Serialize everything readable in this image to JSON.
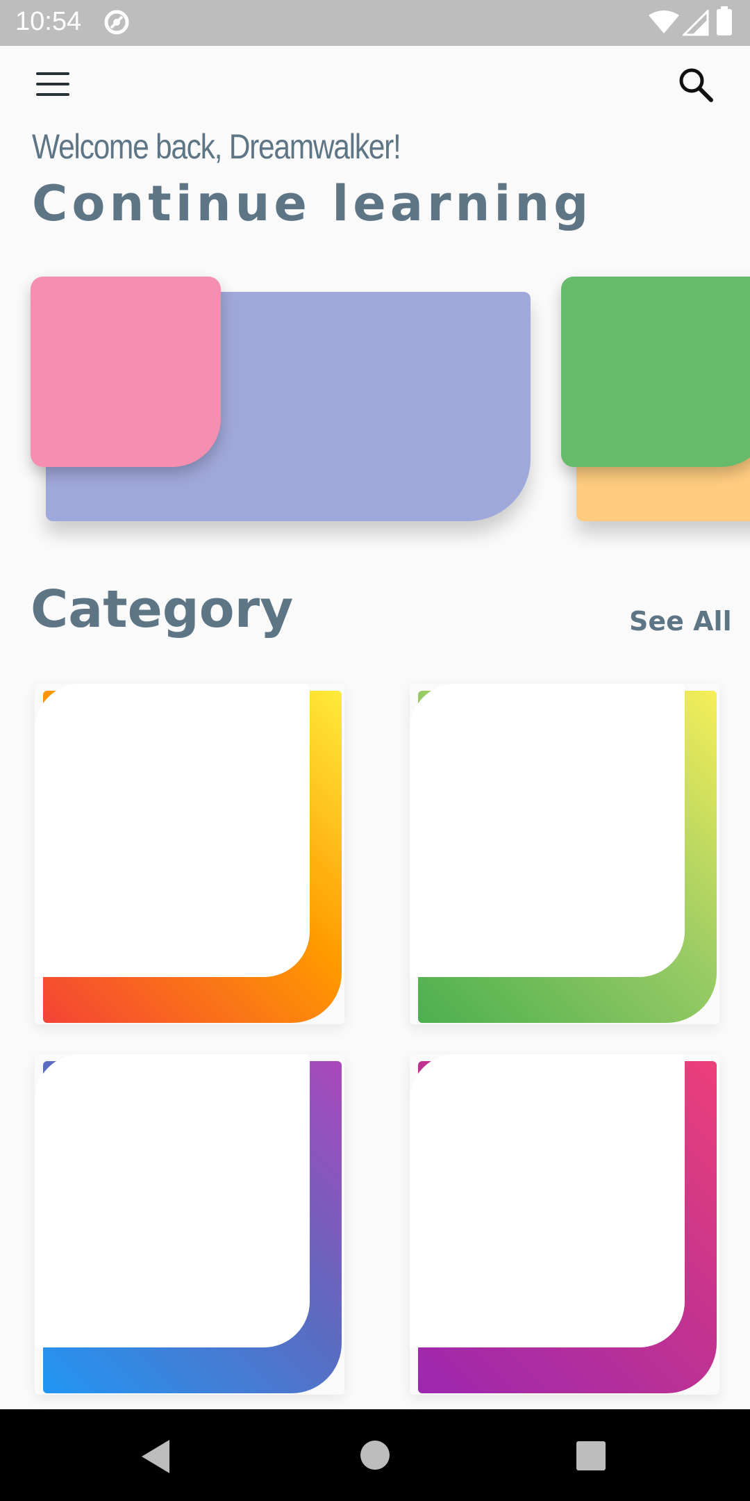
{
  "status_bar": {
    "time": "10:54"
  },
  "app_bar": {
    "menu_icon": "hamburger-menu-icon",
    "search_icon": "search-icon"
  },
  "header": {
    "welcome": "Welcome back, Dreamwalker!",
    "title": "Continue learning"
  },
  "continue_learning": [
    {
      "front_color": "#f48fb1",
      "back_color": "#9fa8da"
    },
    {
      "front_color": "#66bb6a",
      "back_color": "#ffcc80"
    }
  ],
  "category": {
    "title": "Category",
    "see_all": "See All",
    "cards": [
      {
        "gradient": [
          "#f44336",
          "#ffeb3b"
        ]
      },
      {
        "gradient": [
          "#4caf50",
          "#f6ee58"
        ]
      },
      {
        "gradient": [
          "#2196f3",
          "#ab47bc"
        ]
      },
      {
        "gradient": [
          "#9c27b0",
          "#ec407a"
        ]
      }
    ]
  },
  "nav_bar": {
    "back": "back-icon",
    "home": "home-icon",
    "recents": "recents-icon"
  }
}
